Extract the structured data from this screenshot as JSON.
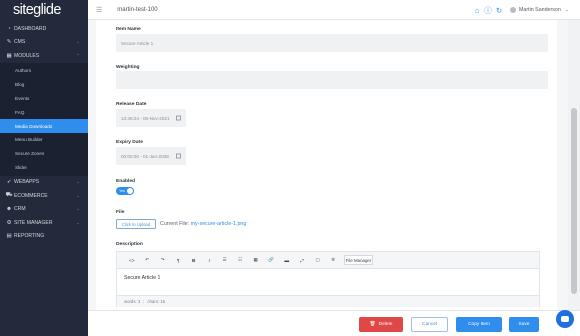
{
  "brand": {
    "logo_text": "siteglide"
  },
  "sidebar": {
    "items": [
      {
        "label": "DASHBOARD",
        "icon": "dashboard-icon"
      },
      {
        "label": "CMS",
        "icon": "edit-icon"
      },
      {
        "label": "MODULES",
        "icon": "modules-icon"
      }
    ],
    "modules_sub": [
      "Authors",
      "Blog",
      "Events",
      "FAQ",
      "Media Downloads",
      "Menu Builder",
      "Secure Zones",
      "Slider"
    ],
    "active_sub": "Media Downloads",
    "items_after": [
      {
        "label": "WEBAPPS",
        "icon": "rocket-icon"
      },
      {
        "label": "ECOMMERCE",
        "icon": "cart-icon"
      },
      {
        "label": "CRM",
        "icon": "users-icon"
      },
      {
        "label": "SITE MANAGER",
        "icon": "gear-icon"
      },
      {
        "label": "REPORTING",
        "icon": "report-icon"
      }
    ]
  },
  "topbar": {
    "site_name": "martin-test-100",
    "user_name": "Martin Sanderson"
  },
  "form": {
    "item_name_label": "Item Name",
    "item_name_value": "Secure Article 1",
    "weighting_label": "Weighting",
    "weighting_value": "",
    "release_date_label": "Release Date",
    "release_date_value": "13:46:24 - 05-Nov-2021",
    "expiry_date_label": "Expiry Date",
    "expiry_date_value": "00:00:00 - 01-Jan-2038",
    "enabled_label": "Enabled",
    "enabled_toggle_text": "Yes",
    "enabled": true,
    "file_label": "File",
    "upload_button": "Click to Upload",
    "current_file_label": "Current File:",
    "current_file_name": "my-secure-article-1.png",
    "description_label": "Description"
  },
  "editor": {
    "toolbar": [
      "<>",
      "↶",
      "↷",
      "¶",
      "B",
      "I",
      "☰",
      "☷",
      "▦",
      "🔗",
      "▬",
      "⤢",
      "▢",
      "✲"
    ],
    "file_manager": "File Manager",
    "content": "Secure Article 1",
    "words": "words: 3",
    "chars": "chars: 16"
  },
  "footer": {
    "delete": "Delete",
    "cancel": "Cancel",
    "copy": "Copy Item",
    "save": "Save"
  }
}
